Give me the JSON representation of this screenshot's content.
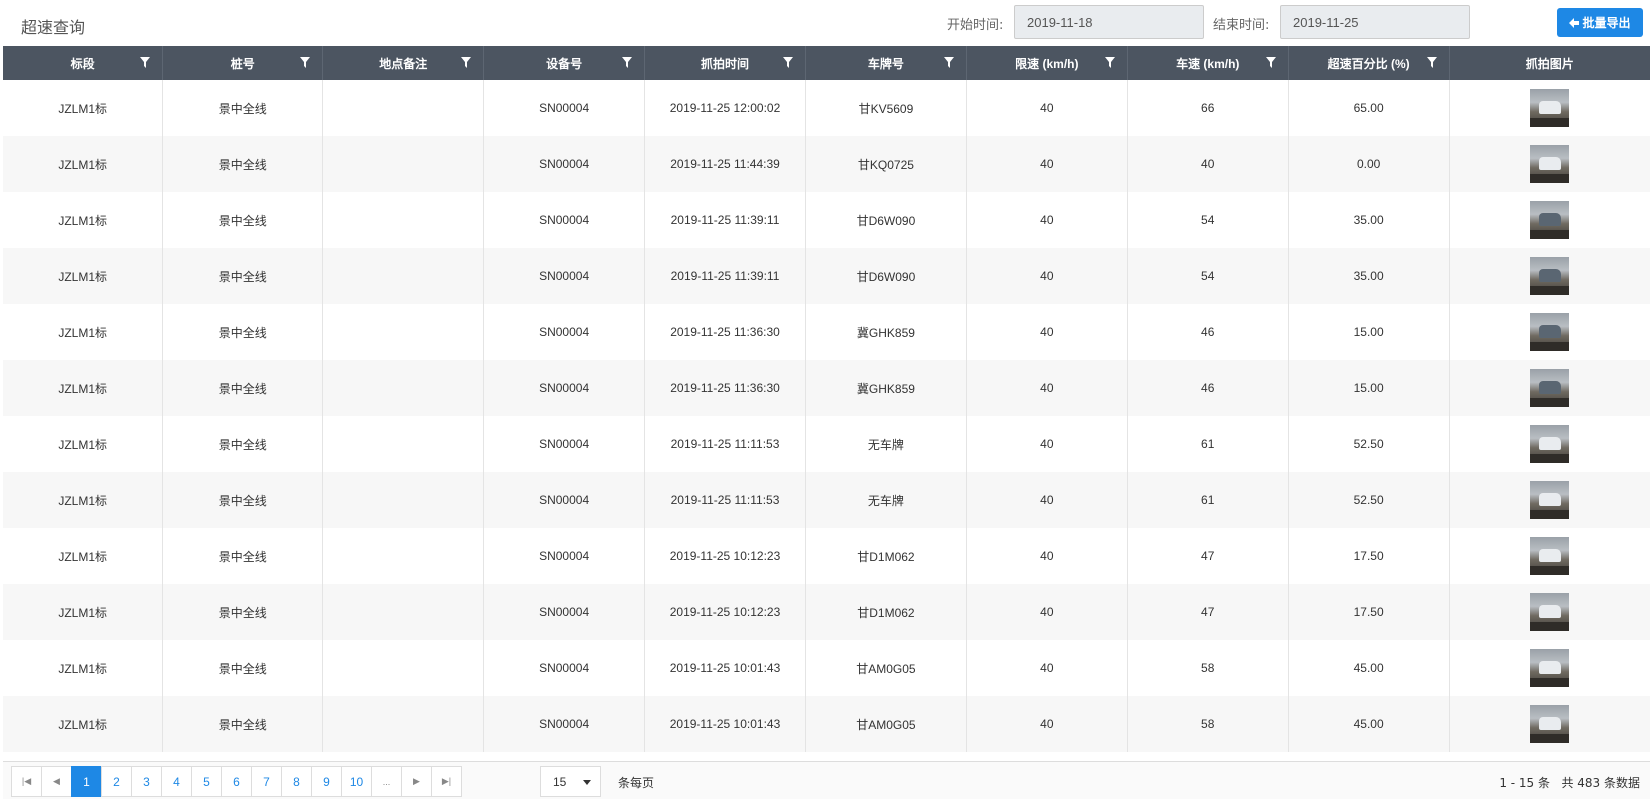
{
  "header": {
    "title": "超速查询",
    "start_label": "开始时间:",
    "start_value": "2019-11-18",
    "end_label": "结束时间:",
    "end_value": "2019-11-25",
    "export_label": "批量导出"
  },
  "table": {
    "columns": [
      "标段",
      "桩号",
      "地点备注",
      "设备号",
      "抓拍时间",
      "车牌号",
      "限速 (km/h)",
      "车速 (km/h)",
      "超速百分比 (%)",
      "抓拍图片"
    ],
    "rows": [
      [
        "JZLM1标",
        "景中全线",
        "",
        "SN00004",
        "2019-11-25 12:00:02",
        "甘KV5609",
        "40",
        "66",
        "65.00"
      ],
      [
        "JZLM1标",
        "景中全线",
        "",
        "SN00004",
        "2019-11-25 11:44:39",
        "甘KQ0725",
        "40",
        "40",
        "0.00"
      ],
      [
        "JZLM1标",
        "景中全线",
        "",
        "SN00004",
        "2019-11-25 11:39:11",
        "甘D6W090",
        "40",
        "54",
        "35.00"
      ],
      [
        "JZLM1标",
        "景中全线",
        "",
        "SN00004",
        "2019-11-25 11:39:11",
        "甘D6W090",
        "40",
        "54",
        "35.00"
      ],
      [
        "JZLM1标",
        "景中全线",
        "",
        "SN00004",
        "2019-11-25 11:36:30",
        "冀GHK859",
        "40",
        "46",
        "15.00"
      ],
      [
        "JZLM1标",
        "景中全线",
        "",
        "SN00004",
        "2019-11-25 11:36:30",
        "冀GHK859",
        "40",
        "46",
        "15.00"
      ],
      [
        "JZLM1标",
        "景中全线",
        "",
        "SN00004",
        "2019-11-25 11:11:53",
        "无车牌",
        "40",
        "61",
        "52.50"
      ],
      [
        "JZLM1标",
        "景中全线",
        "",
        "SN00004",
        "2019-11-25 11:11:53",
        "无车牌",
        "40",
        "61",
        "52.50"
      ],
      [
        "JZLM1标",
        "景中全线",
        "",
        "SN00004",
        "2019-11-25 10:12:23",
        "甘D1M062",
        "40",
        "47",
        "17.50"
      ],
      [
        "JZLM1标",
        "景中全线",
        "",
        "SN00004",
        "2019-11-25 10:12:23",
        "甘D1M062",
        "40",
        "47",
        "17.50"
      ],
      [
        "JZLM1标",
        "景中全线",
        "",
        "SN00004",
        "2019-11-25 10:01:43",
        "甘AM0G05",
        "40",
        "58",
        "45.00"
      ],
      [
        "JZLM1标",
        "景中全线",
        "",
        "SN00004",
        "2019-11-25 10:01:43",
        "甘AM0G05",
        "40",
        "58",
        "45.00"
      ]
    ]
  },
  "pager": {
    "pages": [
      "1",
      "2",
      "3",
      "4",
      "5",
      "6",
      "7",
      "8",
      "9",
      "10",
      "..."
    ],
    "current_page": "1",
    "page_size": "15",
    "per_page_label": "条每页",
    "range_label": "1 - 15 条",
    "total_label": "共 483 条数据"
  }
}
